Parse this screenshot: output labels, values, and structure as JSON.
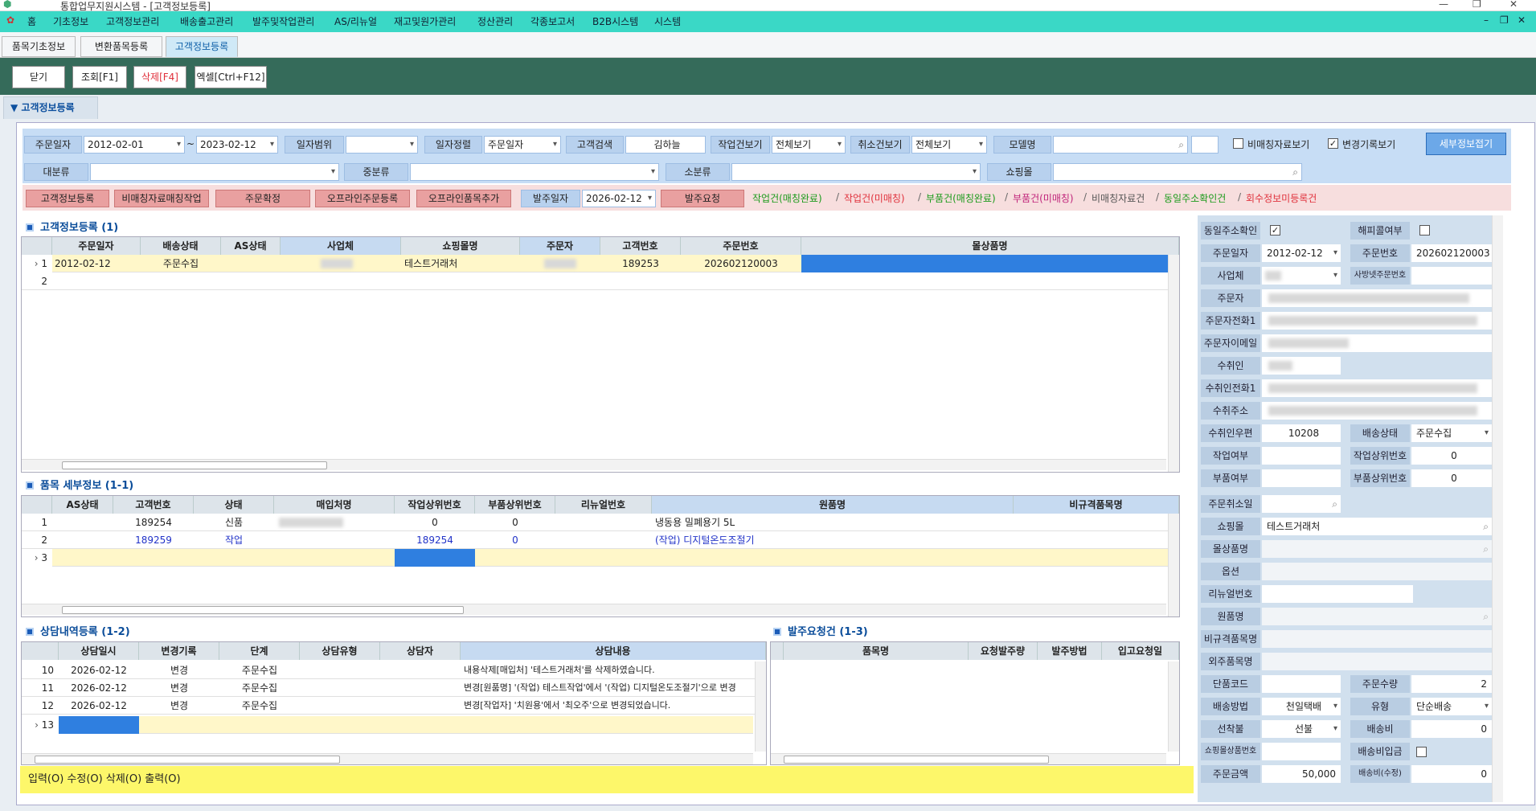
{
  "window": {
    "title": "통합업무지원시스템 - [고객정보등록]"
  },
  "menu": [
    "홈",
    "기초정보",
    "고객정보관리",
    "배송출고관리",
    "발주및작업관리",
    "AS/리뉴얼",
    "재고및원가관리",
    "정산관리",
    "각종보고서",
    "B2B시스템",
    "시스템"
  ],
  "tabs": [
    "품목기초정보",
    "변환품목등록",
    "고객정보등록"
  ],
  "toolbar": {
    "close": "닫기",
    "search": "조회[F1]",
    "delete": "삭제[F4]",
    "excel": "엑셀[Ctrl+F12]"
  },
  "page_tab": "▼ 고객정보등록",
  "filters": {
    "order_date_lbl": "주문일자",
    "date_from": "2012-02-01",
    "tilde": "~",
    "date_to": "2023-02-12",
    "date_range_lbl": "일자범위",
    "date_sort_lbl": "일자정렬",
    "date_sort_val": "주문일자",
    "cust_search_lbl": "고객검색",
    "cust_search_val": "김하늘",
    "work_view_lbl": "작업건보기",
    "work_view_val": "전체보기",
    "cancel_view_lbl": "취소건보기",
    "cancel_view_val": "전체보기",
    "model_lbl": "모델명",
    "nonmatch_lbl": "비매칭자료보기",
    "changelog_lbl": "변경기록보기",
    "detail_btn": "세부정보접기",
    "major_lbl": "대분류",
    "middle_lbl": "중분류",
    "minor_lbl": "소분류",
    "mall_lbl": "쇼핑몰"
  },
  "actions": {
    "b1": "고객정보등록",
    "b2": "비매칭자료매칭작업",
    "b3": "주문확정",
    "b4": "오프라인주문등록",
    "b5": "오프라인품목추가",
    "po_date_lbl": "발주일자",
    "po_date_val": "2026-02-12",
    "b6": "발주요청"
  },
  "links": {
    "l1": "작업건(매칭완료)",
    "l2": "작업건(미매칭)",
    "l3": "부품건(매칭완료)",
    "l4": "부품건(미매칭)",
    "l5": "비매칭자료건",
    "l6": "동일주소확인건",
    "l7": "회수정보미등록건",
    "sep": "/"
  },
  "grid1": {
    "title": "고객정보등록 (1)",
    "headers": [
      "주문일자",
      "배송상태",
      "AS상태",
      "사업체",
      "쇼핑몰명",
      "주문자",
      "고객번호",
      "주문번호",
      "몰상품명"
    ],
    "rows": [
      {
        "no": "1",
        "c": [
          "2012-02-12",
          "주문수집",
          "",
          "",
          "테스트거래처",
          "",
          "189253",
          "202602120003",
          ""
        ]
      },
      {
        "no": "2",
        "c": [
          "",
          "",
          "",
          "",
          "",
          "",
          "",
          "",
          ""
        ]
      }
    ]
  },
  "grid2": {
    "title": "품목 세부정보 (1-1)",
    "headers": [
      "AS상태",
      "고객번호",
      "상태",
      "매입처명",
      "작업상위번호",
      "부품상위번호",
      "리뉴얼번호",
      "원품명",
      "비규격품목명"
    ],
    "rows": [
      {
        "no": "1",
        "c": [
          "",
          "189254",
          "신품",
          "",
          "0",
          "0",
          "",
          "냉동용 밀폐용기 5L",
          ""
        ]
      },
      {
        "no": "2",
        "c": [
          "",
          "189259",
          "작업",
          "",
          "189254",
          "0",
          "",
          "(작업) 디지털온도조절기",
          ""
        ]
      },
      {
        "no": "3",
        "c": [
          "",
          "",
          "",
          "",
          "",
          "",
          "",
          "",
          ""
        ]
      }
    ]
  },
  "grid3": {
    "title": "상담내역등록 (1-2)",
    "headers": [
      "상담일시",
      "변경기록",
      "단계",
      "상담유형",
      "상담자",
      "상담내용"
    ],
    "rows": [
      {
        "no": "10",
        "c": [
          "2026-02-12",
          "변경",
          "주문수집",
          "",
          "",
          "내용삭제[매입처] '테스트거래처'를 삭제하였습니다."
        ]
      },
      {
        "no": "11",
        "c": [
          "2026-02-12",
          "변경",
          "주문수집",
          "",
          "",
          "변경[원품명] '(작업) 테스트작업'에서 '(작업) 디지털온도조절기'으로 변경"
        ]
      },
      {
        "no": "12",
        "c": [
          "2026-02-12",
          "변경",
          "주문수집",
          "",
          "",
          "변경[작업자] '치원용'에서 '최오주'으로 변경되었습니다."
        ]
      },
      {
        "no": "13",
        "c": [
          "",
          "",
          "",
          "",
          "",
          ""
        ]
      }
    ]
  },
  "grid4": {
    "title": "발주요청건 (1-3)",
    "headers": [
      "품목명",
      "요청발주량",
      "발주방법",
      "입고요청일"
    ]
  },
  "right": {
    "same_addr": "동일주소확인",
    "hpcl": "해피콜여부",
    "order_date": "주문일자",
    "order_date_v": "2012-02-12",
    "order_no": "주문번호",
    "order_no_v": "202602120003",
    "biz": "사업체",
    "biz_order_no": "사방넷주문번호",
    "orderer": "주문자",
    "orderer_tel": "주문자전화1",
    "orderer_mail": "주문자이메일",
    "recv": "수취인",
    "recv_tel": "수취인전화1",
    "recv_addr": "수취주소",
    "zip": "수취인우편",
    "zip_v": "10208",
    "ship_state": "배송상태",
    "ship_state_v": "주문수집",
    "work_yn": "작업여부",
    "work_up": "작업상위번호",
    "work_up_v": "0",
    "part_yn": "부품여부",
    "part_up": "부품상위번호",
    "part_up_v": "0",
    "cancel": "주문취소일",
    "mall": "쇼핑몰",
    "mall_v": "테스트거래처",
    "mall_item": "몰상품명",
    "option": "옵션",
    "renew": "리뉴얼번호",
    "orig": "원품명",
    "nonstd": "비규격품목명",
    "outer": "외주품목명",
    "item_code": "단품코드",
    "qty": "주문수량",
    "qty_v": "2",
    "ship_method": "배송방법",
    "ship_method_v": "천일택배",
    "type": "유형",
    "type_v": "단순배송",
    "prepaid": "선착불",
    "prepaid_v": "선불",
    "ship_fee": "배송비",
    "ship_fee_v": "0",
    "mall_prod_no": "쇼핑몰상품번호",
    "ship_fee_paid": "배송비입금",
    "order_amt": "주문금액",
    "order_amt_v": "50,000",
    "ship_fee2": "배송비(수정)",
    "ship_fee2_v": "0"
  },
  "status": "입력(O) 수정(O) 삭제(O) 출력(O)",
  "colors": {
    "menu": "#3ad8c6",
    "toolbar": "#356b5a",
    "filter": "#c7ddf5",
    "selected": "#2f7fe0",
    "status": "#fdf76a"
  }
}
